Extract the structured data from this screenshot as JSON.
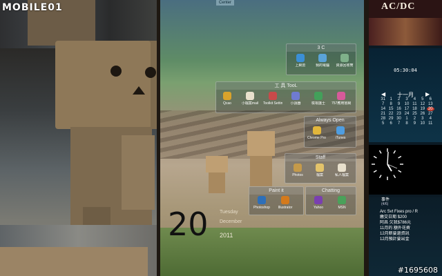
{
  "watermark": "MOBILE01",
  "image_id": "#1695608",
  "top_tab": "Center",
  "album": {
    "title": "AC/DC"
  },
  "fences": {
    "c3": {
      "title": "3 C",
      "icons": [
        {
          "name": "ie-icon",
          "label": "上網去",
          "color": "#3b8fd6"
        },
        {
          "name": "computer-icon",
          "label": "我的電腦",
          "color": "#5aa3d8"
        },
        {
          "name": "recycle-icon",
          "label": "資源回收筒",
          "color": "#7fb08a"
        }
      ]
    },
    "tools": {
      "title": "工 具 TooL",
      "icons": [
        {
          "name": "chrome-icon",
          "label": "Qcao",
          "color": "#d9a32b"
        },
        {
          "name": "files-icon",
          "label": "小檔案mail",
          "color": "#e8e0cc"
        },
        {
          "name": "hp-icon",
          "label": "Toolkit Settin...",
          "color": "#c84a4a"
        },
        {
          "name": "note-icon",
          "label": "小說器",
          "color": "#6f7bd0"
        },
        {
          "name": "shield-icon",
          "label": "檢視護士",
          "color": "#43a05a"
        },
        {
          "name": "pinwheel-icon",
          "label": "757應用官網",
          "color": "#d65a9a"
        }
      ]
    },
    "always": {
      "title": "Always Open",
      "icons": [
        {
          "name": "chrome-browser-icon",
          "label": "Chrome Pro 瀏覽",
          "color": "#e2b63c"
        },
        {
          "name": "itunes-icon",
          "label": "iTunes",
          "color": "#4f9de0"
        }
      ]
    },
    "staff": {
      "title": "Staff",
      "icons": [
        {
          "name": "folder-icon",
          "label": "Photos",
          "color": "#c59a4a"
        },
        {
          "name": "folder2-icon",
          "label": "檔案",
          "color": "#e3c36a"
        },
        {
          "name": "document-icon",
          "label": "私人檔案",
          "color": "#e8e0cc"
        }
      ]
    },
    "paint": {
      "title": "Paint it",
      "icons": [
        {
          "name": "photoshop-icon",
          "label": "Photoshop",
          "color": "#2e6fb8"
        },
        {
          "name": "illustrator-icon",
          "label": "Illustrator",
          "color": "#d47a1c"
        }
      ]
    },
    "chatting": {
      "title": "Chatting",
      "icons": [
        {
          "name": "yahoo-icon",
          "label": "Yahoo",
          "color": "#7a3fb0"
        },
        {
          "name": "msn-icon",
          "label": "MSN",
          "color": "#4aa15a"
        }
      ]
    }
  },
  "date": {
    "day_number": "20",
    "weekday": "Tuesday",
    "month": "December",
    "year": "2011"
  },
  "calendar": {
    "time": "05:30:04",
    "month_label": "十一月",
    "prev": "◀",
    "next": "▶",
    "rows": [
      [
        "31",
        "1",
        "2",
        "3",
        "4",
        "5",
        "6"
      ],
      [
        "7",
        "8",
        "9",
        "10",
        "11",
        "12",
        "13"
      ],
      [
        "14",
        "15",
        "16",
        "17",
        "18",
        "19",
        "20"
      ],
      [
        "21",
        "22",
        "23",
        "24",
        "25",
        "26",
        "27"
      ],
      [
        "28",
        "29",
        "30",
        "1",
        "2",
        "3",
        "4"
      ],
      [
        "5",
        "6",
        "7",
        "8",
        "9",
        "10",
        "11"
      ]
    ],
    "today": "20"
  },
  "notes": {
    "title": "事件",
    "subtitle": "(4/6)",
    "items": [
      "Arc Svt Fixes pro / R",
      "繳交日期 $200",
      "阿昌 欠我$786元",
      "11月的 額外花費",
      "12月薪要還資訊",
      "12月預計要出金"
    ]
  }
}
